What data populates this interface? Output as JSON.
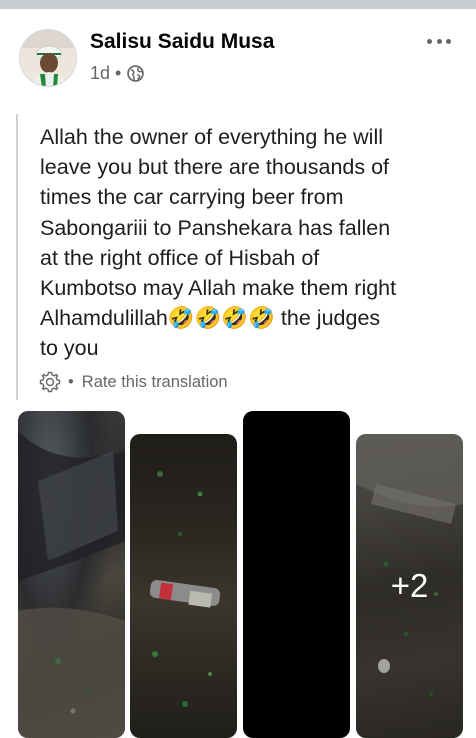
{
  "post": {
    "author_name": "Salisu Saidu Musa",
    "timestamp": "1d",
    "separator": "•",
    "privacy_icon": "globe-icon",
    "more_icon": "more-options-icon",
    "text_lines": [
      "Allah the owner of everything he will",
      "leave you but there are thousands of",
      "times the car carrying beer from",
      "Sabongariii to Panshekara has fallen",
      "at the right office of Hisbah of",
      "Kumbotso may Allah make them right",
      "Alhamdulillah🤣🤣🤣🤣 the judges",
      "to you"
    ],
    "rate_translation": {
      "icon": "gear-icon",
      "separator": "•",
      "label": "Rate this translation"
    }
  },
  "photos": {
    "extra_count": "+2"
  },
  "colors": {
    "divider": "#c9ccd1",
    "secondary_text": "#65676b",
    "primary_text": "#050505"
  }
}
